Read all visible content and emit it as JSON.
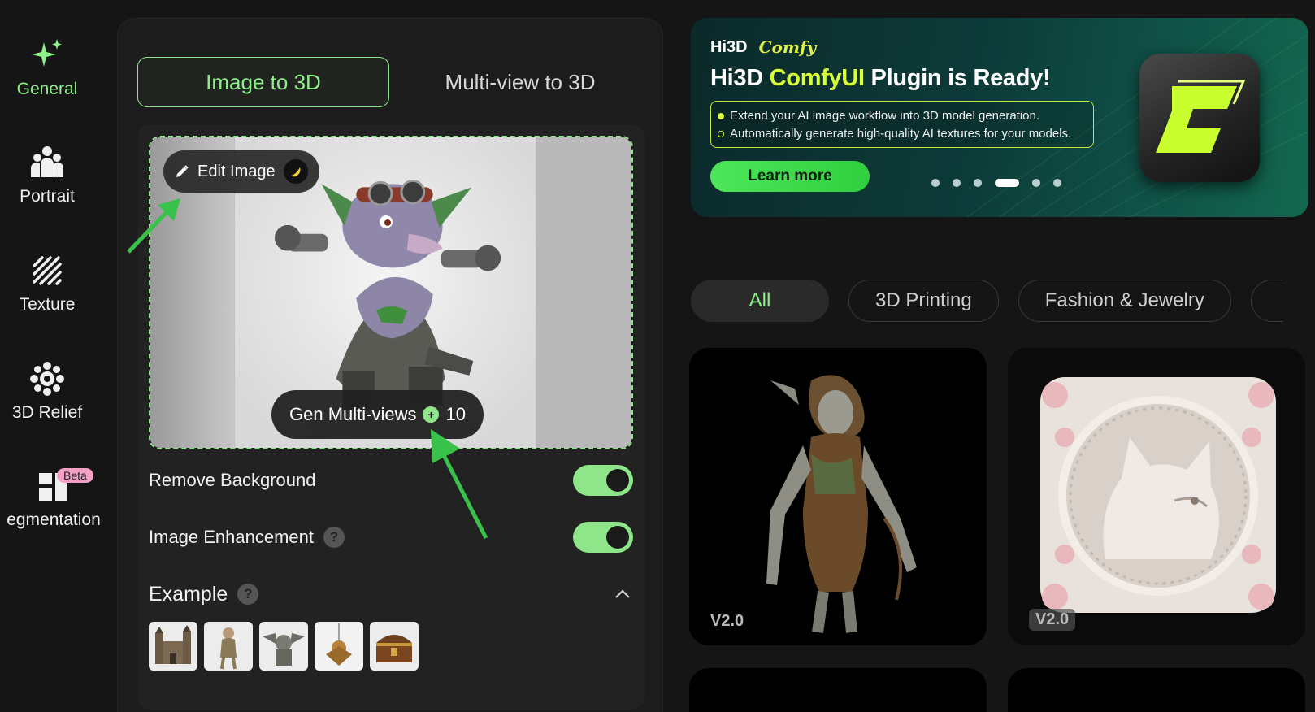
{
  "sidebar": {
    "items": [
      {
        "label": "General",
        "icon": "sparkle-icon",
        "active": true
      },
      {
        "label": "Portrait",
        "icon": "people-icon"
      },
      {
        "label": "Texture",
        "icon": "hatch-texture-icon"
      },
      {
        "label": "3D Relief",
        "icon": "gear-flower-icon"
      },
      {
        "label": "egmentation",
        "icon": "segmentation-icon",
        "badge": "Beta"
      }
    ]
  },
  "panel": {
    "tabs": [
      {
        "label": "Image to 3D",
        "active": true
      },
      {
        "label": "Multi-view to 3D",
        "active": false
      }
    ],
    "edit_image_label": "Edit Image",
    "gen_multiviews_label": "Gen Multi-views",
    "gen_multiviews_cost": "10",
    "remove_background_label": "Remove Background",
    "remove_background_on": true,
    "image_enhancement_label": "Image Enhancement",
    "image_enhancement_on": true,
    "example_label": "Example",
    "examples": [
      "castle",
      "elf-figure",
      "gargoyle",
      "pendant",
      "treasure-chest"
    ]
  },
  "banner": {
    "brand": "Hi3D",
    "partner": "Comfy",
    "title_prefix": "Hi3D ",
    "title_highlight": "ComfyUI",
    "title_suffix": " Plugin is Ready!",
    "bullets": [
      "Extend your AI image workflow into 3D model generation.",
      "Automatically generate high-quality AI textures for your models."
    ],
    "cta": "Learn more",
    "slide_count": 6,
    "active_slide": 3
  },
  "filters": [
    {
      "label": "All",
      "active": true
    },
    {
      "label": "3D Printing",
      "active": false
    },
    {
      "label": "Fashion & Jewelry",
      "active": false
    }
  ],
  "cards": [
    {
      "version": "V2.0",
      "subject": "tree-nymph-statue"
    },
    {
      "version": "V2.0",
      "subject": "cat-relief-frame"
    }
  ],
  "colors": {
    "accent": "#8ff08a",
    "banner_highlight": "#d8ff3a",
    "background": "#151515",
    "panel": "#1c1c1c"
  }
}
